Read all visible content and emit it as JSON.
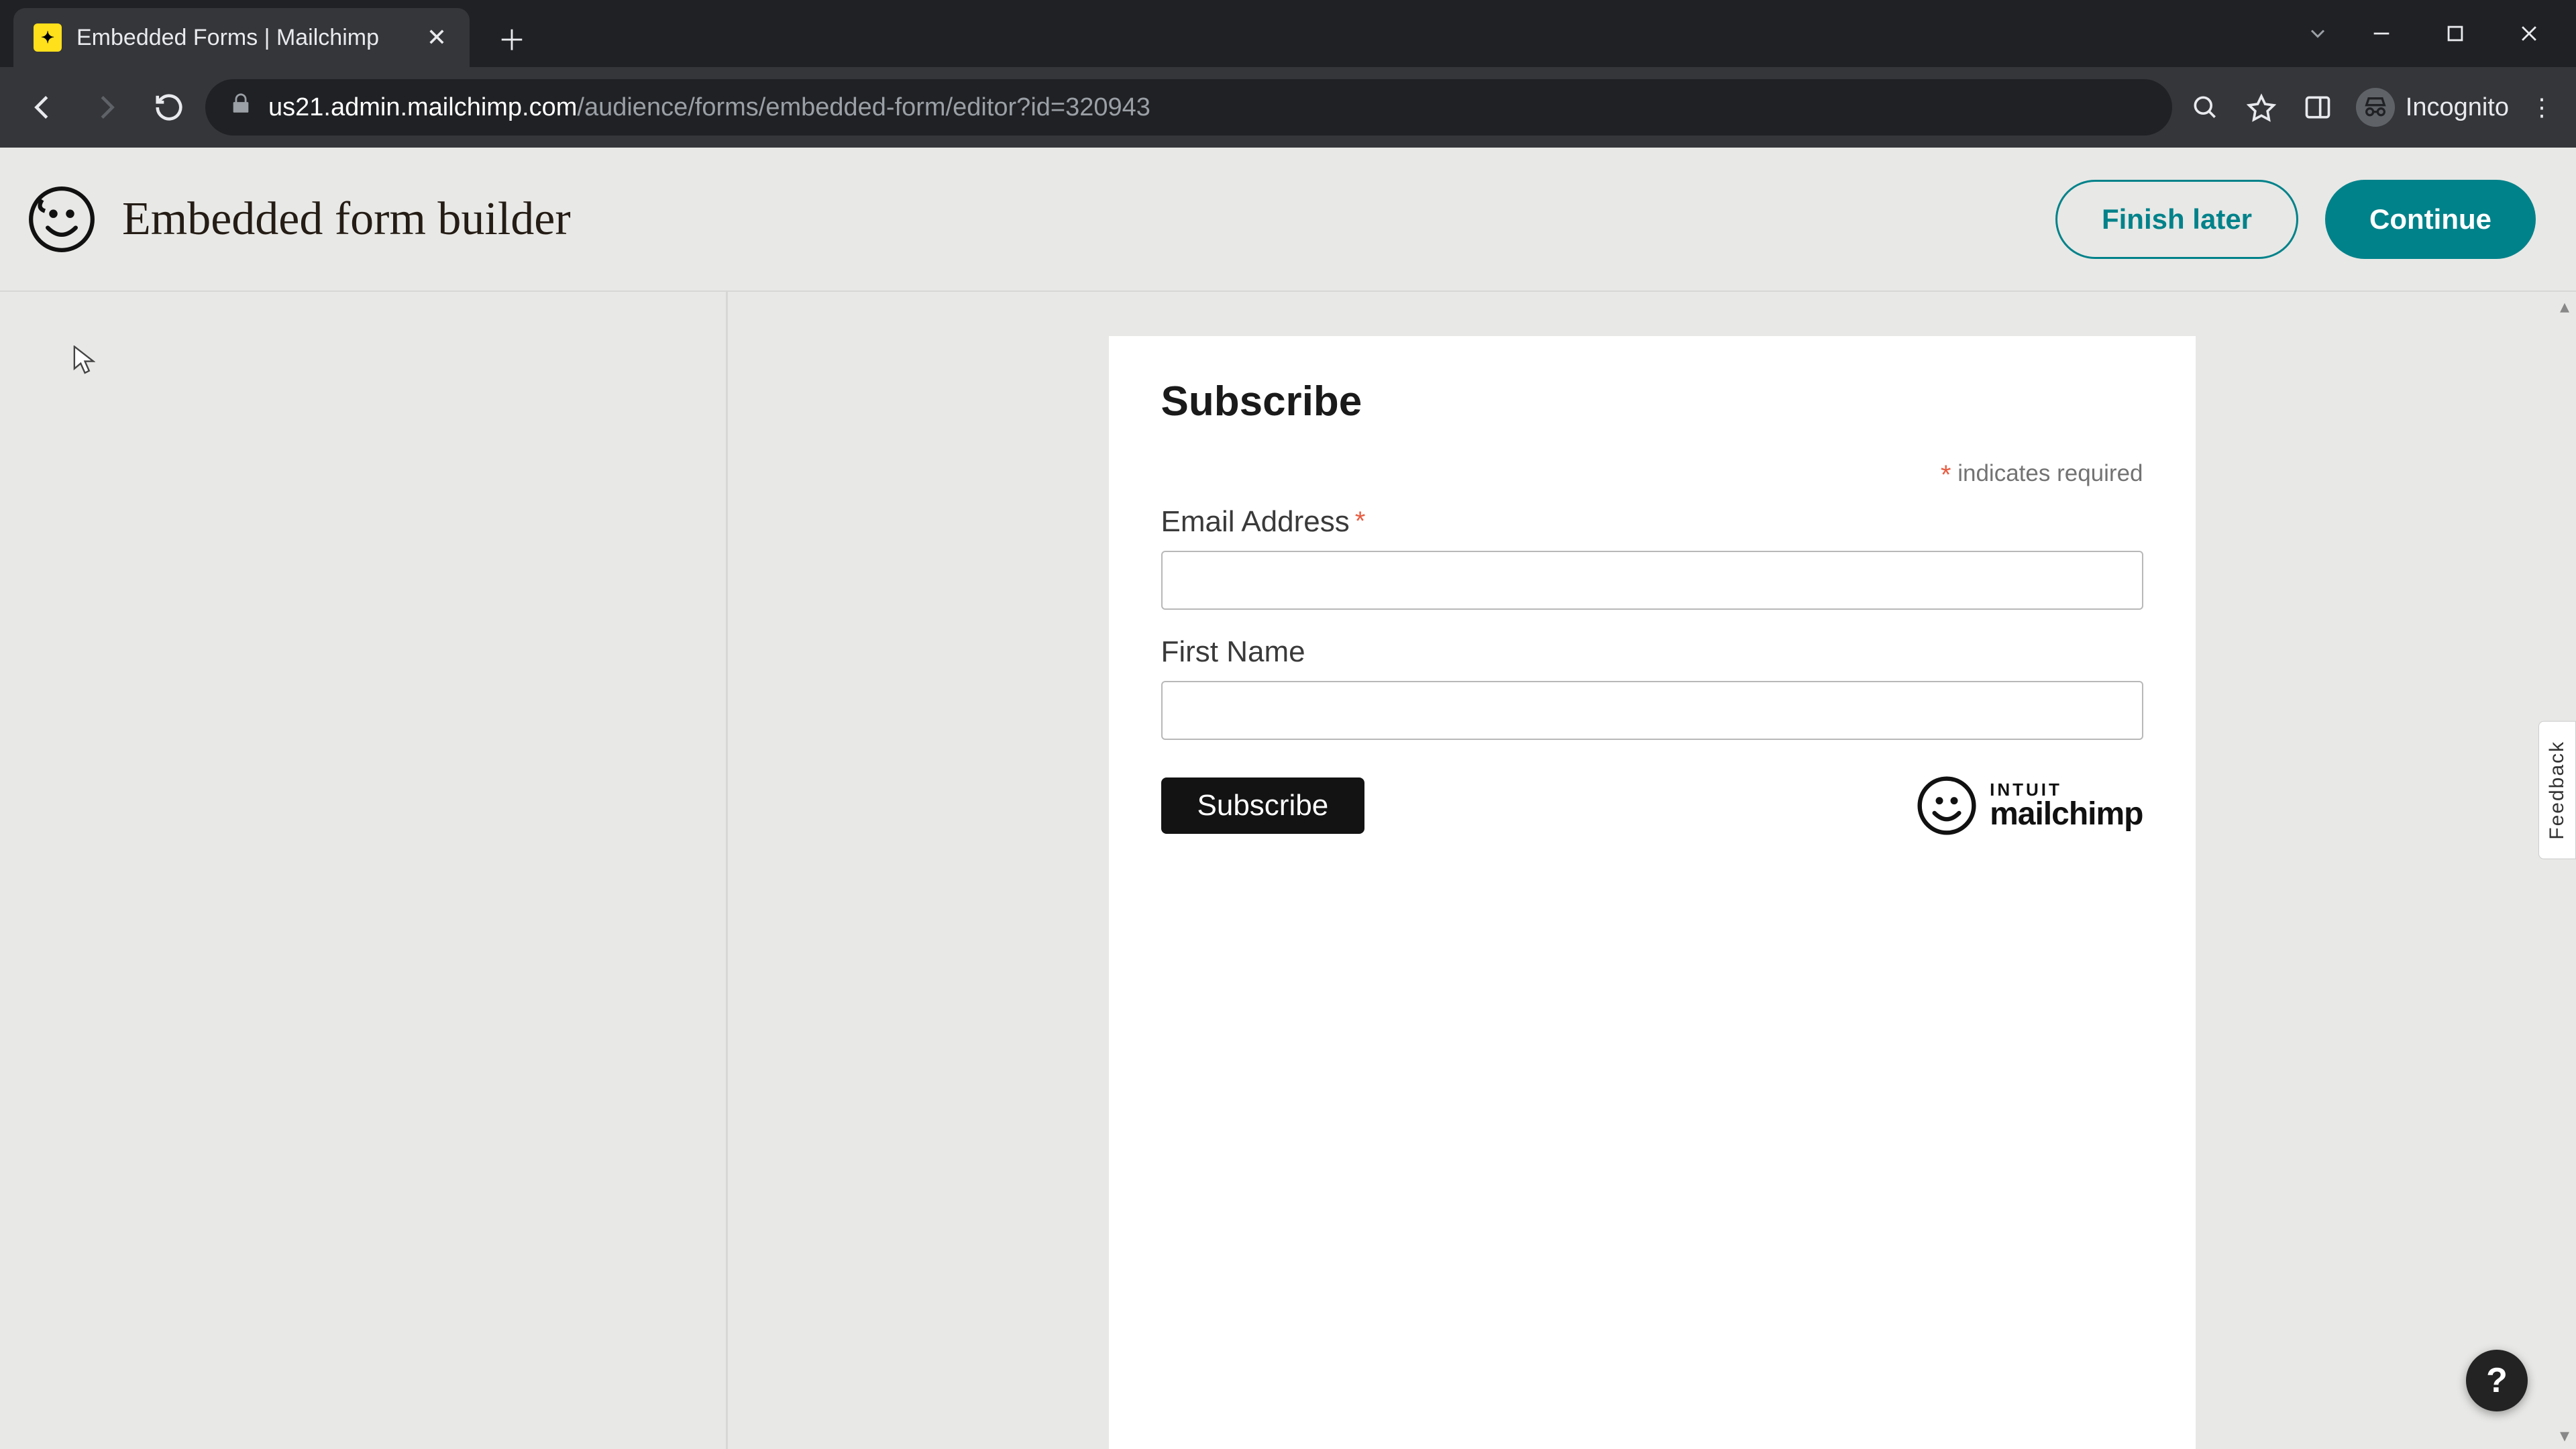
{
  "browser": {
    "tab_title": "Embedded Forms | Mailchimp",
    "url_host": "us21.admin.mailchimp.com",
    "url_path": "/audience/forms/embedded-form/editor?id=320943",
    "incognito_label": "Incognito"
  },
  "header": {
    "title": "Embedded form builder",
    "finish_later_label": "Finish later",
    "continue_label": "Continue"
  },
  "form": {
    "heading": "Subscribe",
    "required_note": "indicates required",
    "fields": [
      {
        "label": "Email Address",
        "required": true
      },
      {
        "label": "First Name",
        "required": false
      }
    ],
    "submit_label": "Subscribe",
    "badge_top": "INTUIT",
    "badge_bottom": "mailchimp"
  },
  "feedback_label": "Feedback",
  "help_label": "?"
}
